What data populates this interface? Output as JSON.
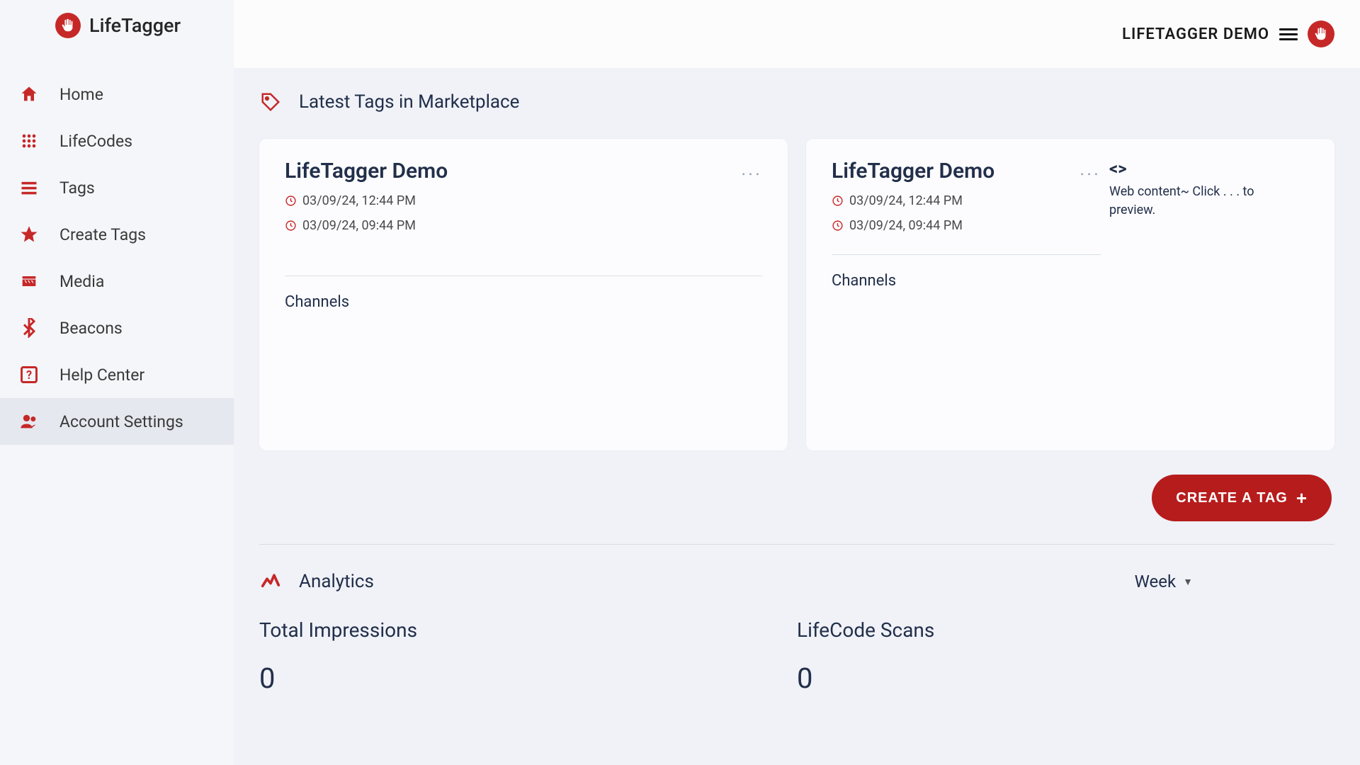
{
  "app": {
    "name": "LifeTagger"
  },
  "topbar": {
    "user": "LIFETAGGER DEMO"
  },
  "sidebar": {
    "items": [
      {
        "label": "Home",
        "icon": "home"
      },
      {
        "label": "LifeCodes",
        "icon": "grid-dots"
      },
      {
        "label": "Tags",
        "icon": "menu-lines"
      },
      {
        "label": "Create Tags",
        "icon": "star"
      },
      {
        "label": "Media",
        "icon": "clapboard"
      },
      {
        "label": "Beacons",
        "icon": "bluetooth"
      },
      {
        "label": "Help Center",
        "icon": "help"
      },
      {
        "label": "Account Settings",
        "icon": "people"
      }
    ],
    "active_index": 7
  },
  "latest_tags": {
    "title": "Latest Tags in Marketplace",
    "cards": [
      {
        "title": "LifeTagger Demo",
        "ts1": "03/09/24, 12:44 PM",
        "ts2": "03/09/24, 09:44 PM",
        "channels_label": "Channels",
        "preview": null
      },
      {
        "title": "LifeTagger Demo",
        "ts1": "03/09/24, 12:44 PM",
        "ts2": "03/09/24, 09:44 PM",
        "channels_label": "Channels",
        "preview": "Web content~ Click . . . to preview."
      }
    ]
  },
  "create_button": {
    "label": "CREATE A TAG"
  },
  "analytics": {
    "title": "Analytics",
    "range": "Week",
    "metrics": [
      {
        "label": "Total Impressions",
        "value": "0"
      },
      {
        "label": "LifeCode Scans",
        "value": "0"
      }
    ]
  }
}
